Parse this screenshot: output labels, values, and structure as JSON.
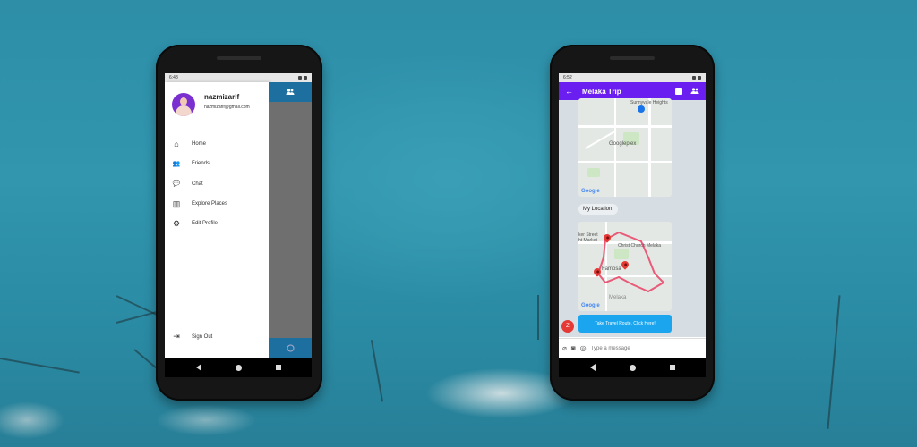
{
  "status": {
    "time_left": "6:48",
    "time_right": "6:52"
  },
  "drawer": {
    "user_name": "nazmizarif",
    "user_email": "nazmizarif@gmail.com",
    "items": [
      {
        "label": "Home",
        "icon": "home-icon",
        "glyph": "⌂"
      },
      {
        "label": "Friends",
        "icon": "friends-icon",
        "glyph": "👥"
      },
      {
        "label": "Chat",
        "icon": "chat-icon",
        "glyph": "💬"
      },
      {
        "label": "Explore Places",
        "icon": "map-icon",
        "glyph": "▥"
      },
      {
        "label": "Edit Profile",
        "icon": "settings-icon",
        "glyph": "⚙"
      }
    ],
    "signout_label": "Sign Out"
  },
  "chat": {
    "title": "Melaka Trip",
    "my_location_label": "My Location:",
    "map1_labels": {
      "top": "Sunnyvale Heights",
      "place": "Googleplex",
      "brand": "Google"
    },
    "map2_labels": {
      "market": "ker Street\nht Market",
      "church": "Christ Church Melaka",
      "famosa": "Famosa",
      "area": "Melaka",
      "brand": "Google"
    },
    "route_button_label": "Take Travel Route. Click Here!",
    "sender_initial": "Z",
    "message_placeholder": "Type a message"
  },
  "colors": {
    "appbar": "#6a1ff0",
    "drawer_accent": "#1d6fa0",
    "route_button": "#1aa5ee",
    "badge": "#e53935"
  }
}
